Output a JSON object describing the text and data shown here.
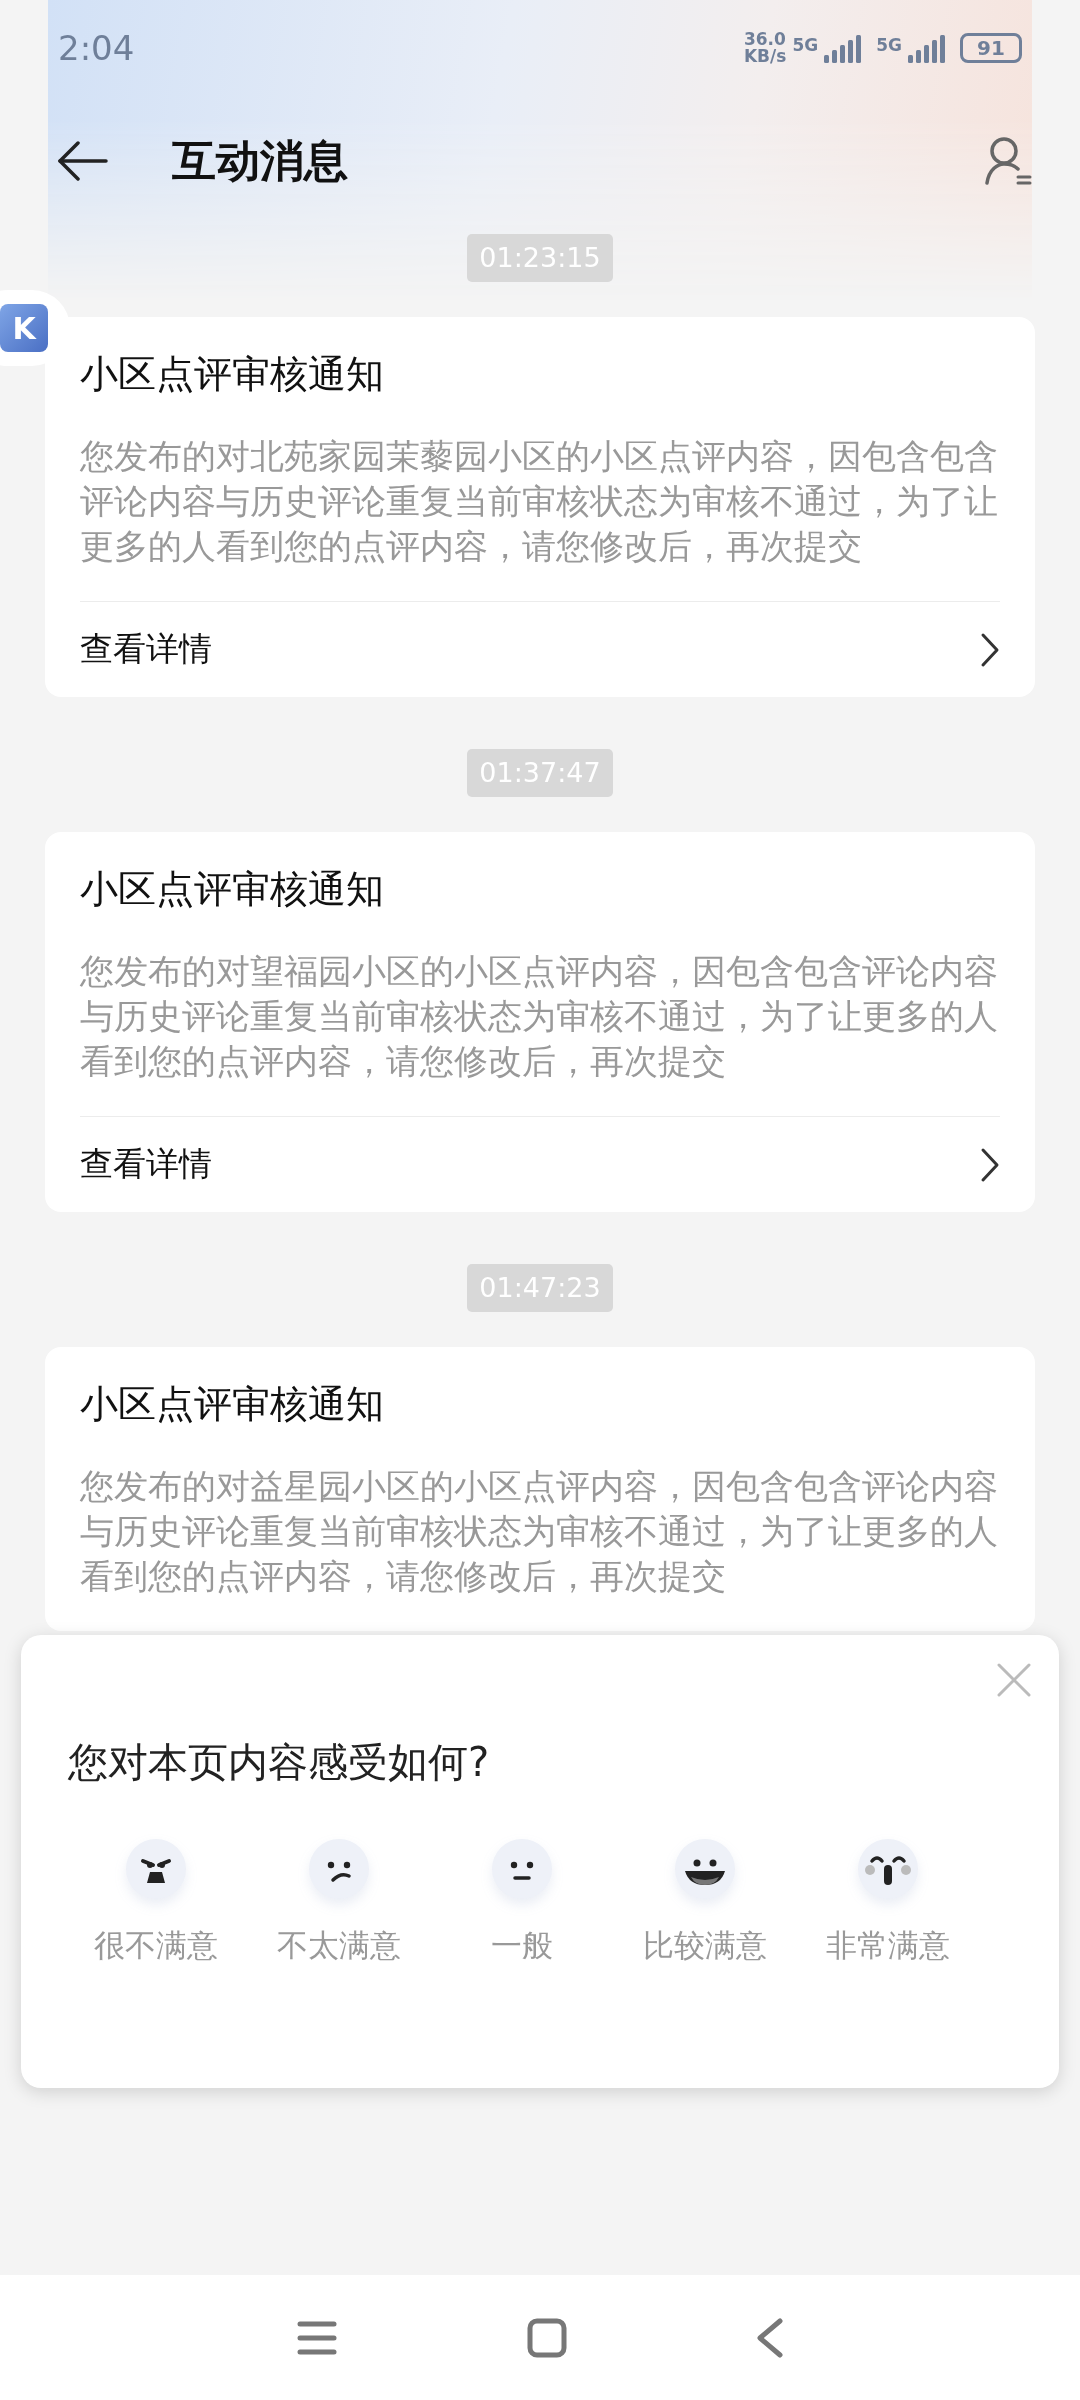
{
  "status_bar": {
    "time": "2:04",
    "net_speed": [
      "36.0",
      "KB/s"
    ],
    "network_labels": [
      "5G",
      "5G"
    ],
    "battery": "91"
  },
  "header": {
    "title": "互动消息"
  },
  "floating_button": {
    "label": "K"
  },
  "messages": [
    {
      "time": "01:23:15",
      "title": "小区点评审核通知",
      "body": "您发布的对北苑家园茉藜园小区的小区点评内容，因包含包含评论内容与历史评论重复当前审核状态为审核不通过，为了让更多的人看到您的点评内容，请您修改后，再次提交",
      "link": "查看详情"
    },
    {
      "time": "01:37:47",
      "title": "小区点评审核通知",
      "body": "您发布的对望福园小区的小区点评内容，因包含包含评论内容与历史评论重复当前审核状态为审核不通过，为了让更多的人看到您的点评内容，请您修改后，再次提交",
      "link": "查看详情"
    },
    {
      "time": "01:47:23",
      "title": "小区点评审核通知",
      "body": "您发布的对益星园小区的小区点评内容，因包含包含评论内容与历史评论重复当前审核状态为审核不通过，为了让更多的人看到您的点评内容，请您修改后，再次提交"
    }
  ],
  "feedback": {
    "question": "您对本页内容感受如何?",
    "options": [
      {
        "kind": "angry",
        "label": "很不满意"
      },
      {
        "kind": "unhappy",
        "label": "不太满意"
      },
      {
        "kind": "neutral",
        "label": "一般"
      },
      {
        "kind": "happy",
        "label": "比较满意"
      },
      {
        "kind": "delighted",
        "label": "非常满意"
      }
    ]
  }
}
